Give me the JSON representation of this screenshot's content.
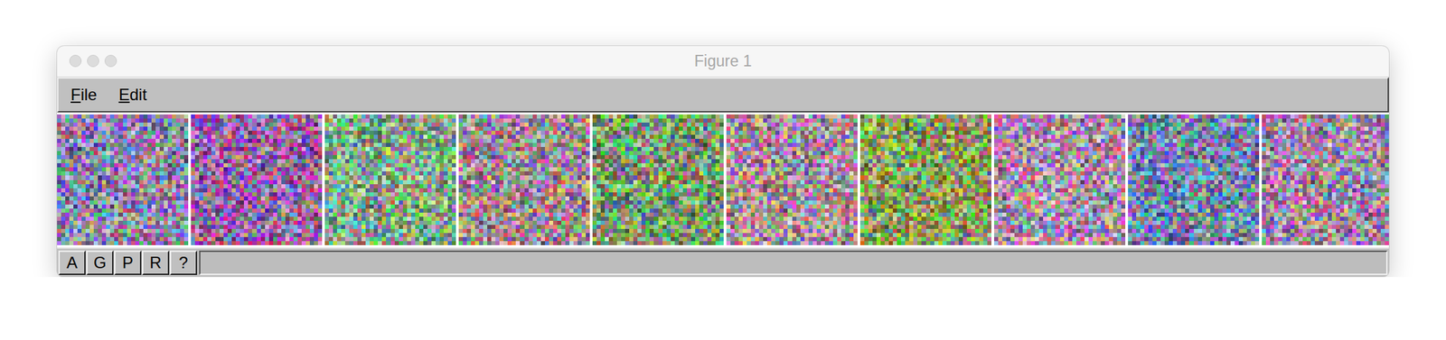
{
  "window": {
    "title": "Figure 1"
  },
  "menu": [
    "File",
    "Edit"
  ],
  "images": [
    {
      "color": "#8a84a8"
    },
    {
      "color": "#9868a0"
    },
    {
      "color": "#88a688"
    },
    {
      "color": "#a08a92"
    },
    {
      "color": "#7a9a70"
    },
    {
      "color": "#a8909a"
    },
    {
      "color": "#8c9a62"
    },
    {
      "color": "#a890a4"
    },
    {
      "color": "#7886aa"
    },
    {
      "color": "#9c8aa2"
    }
  ],
  "toolbar": [
    "A",
    "G",
    "P",
    "R",
    "?"
  ],
  "status_bar": ""
}
